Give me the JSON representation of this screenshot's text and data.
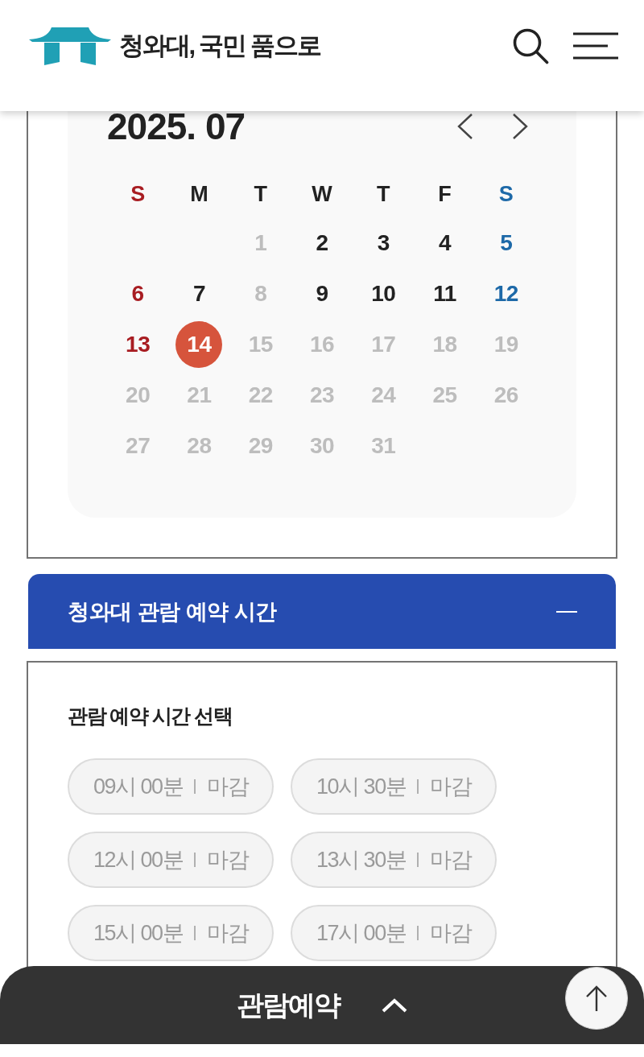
{
  "header": {
    "title": "청와대, 국민 품으로"
  },
  "calendar": {
    "title": "2025. 07",
    "weekdays": [
      {
        "label": "S",
        "color": "#a81d22"
      },
      {
        "label": "M",
        "color": "#222222"
      },
      {
        "label": "T",
        "color": "#222222"
      },
      {
        "label": "W",
        "color": "#222222"
      },
      {
        "label": "T",
        "color": "#222222"
      },
      {
        "label": "F",
        "color": "#222222"
      },
      {
        "label": "S",
        "color": "#1d69a8"
      }
    ],
    "weeks": [
      [
        {
          "day": "1",
          "available": false,
          "selected": false
        },
        {
          "day": "2",
          "available": true,
          "selected": false
        },
        {
          "day": "3",
          "available": true,
          "selected": false
        },
        {
          "day": "4",
          "available": true,
          "selected": false
        },
        {
          "day": "5",
          "available": true,
          "selected": false
        }
      ],
      [
        {
          "day": "6",
          "available": true,
          "selected": false
        },
        {
          "day": "7",
          "available": true,
          "selected": false
        },
        {
          "day": "8",
          "available": false,
          "selected": false
        },
        {
          "day": "9",
          "available": true,
          "selected": false
        },
        {
          "day": "10",
          "available": true,
          "selected": false
        },
        {
          "day": "11",
          "available": true,
          "selected": false
        },
        {
          "day": "12",
          "available": true,
          "selected": false
        }
      ],
      [
        {
          "day": "13",
          "available": true,
          "selected": false
        },
        {
          "day": "14",
          "available": true,
          "selected": true
        },
        {
          "day": "15",
          "available": false,
          "selected": false
        },
        {
          "day": "16",
          "available": false,
          "selected": false
        },
        {
          "day": "17",
          "available": false,
          "selected": false
        },
        {
          "day": "18",
          "available": false,
          "selected": false
        },
        {
          "day": "19",
          "available": false,
          "selected": false
        }
      ],
      [
        {
          "day": "20",
          "available": false,
          "selected": false
        },
        {
          "day": "21",
          "available": false,
          "selected": false
        },
        {
          "day": "22",
          "available": false,
          "selected": false
        },
        {
          "day": "23",
          "available": false,
          "selected": false
        },
        {
          "day": "24",
          "available": false,
          "selected": false
        },
        {
          "day": "25",
          "available": false,
          "selected": false
        },
        {
          "day": "26",
          "available": false,
          "selected": false
        }
      ],
      [
        {
          "day": "27",
          "available": false,
          "selected": false
        },
        {
          "day": "28",
          "available": false,
          "selected": false
        },
        {
          "day": "29",
          "available": false,
          "selected": false
        },
        {
          "day": "30",
          "available": false,
          "selected": false
        },
        {
          "day": "31",
          "available": false,
          "selected": false
        }
      ]
    ]
  },
  "reservation_time": {
    "title": "청와대 관람 예약 시간",
    "expanded": true,
    "subtitle": "관람 예약 시간 선택",
    "slots": [
      {
        "time": "09시 00분",
        "status": "마감",
        "disabled": true
      },
      {
        "time": "10시 30분",
        "status": "마감",
        "disabled": true
      },
      {
        "time": "12시 00분",
        "status": "마감",
        "disabled": true
      },
      {
        "time": "13시 30분",
        "status": "마감",
        "disabled": true
      },
      {
        "time": "15시 00분",
        "status": "마감",
        "disabled": true
      },
      {
        "time": "17시 00분",
        "status": "마감",
        "disabled": true
      }
    ]
  },
  "bottom_bar": {
    "label": "관람예약"
  }
}
